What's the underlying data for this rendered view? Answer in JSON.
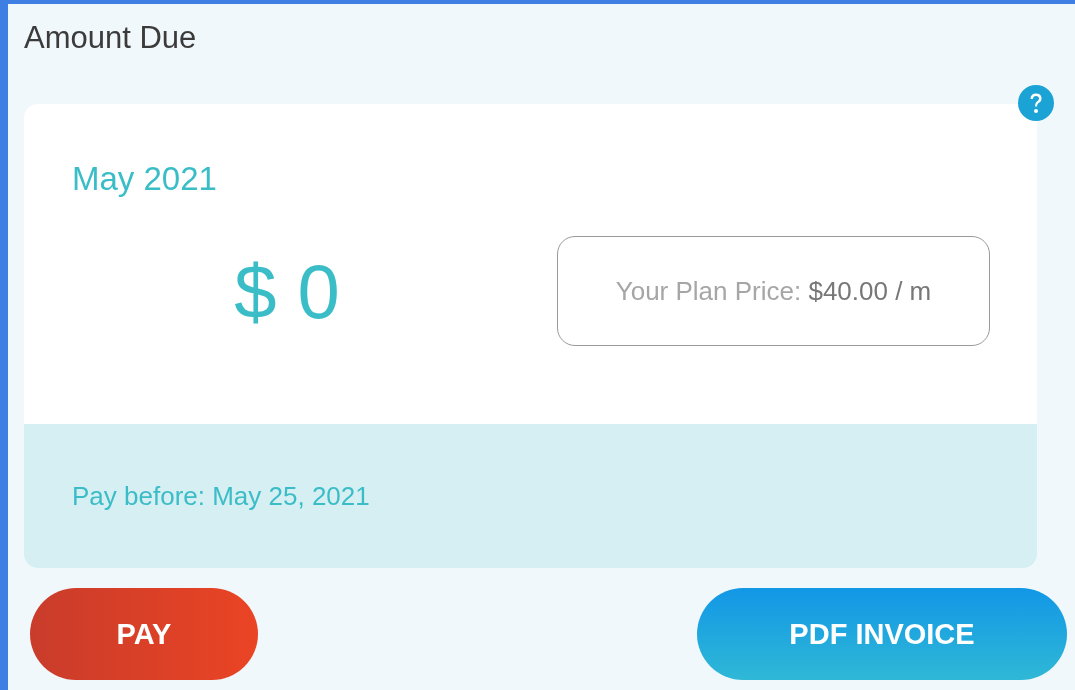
{
  "title": "Amount Due",
  "card": {
    "month": "May 2021",
    "amount": "$ 0",
    "plan_price": "Your Plan Price: **$40.00 / m**",
    "pay_before": "Pay before: May 25, 2021"
  },
  "buttons": [
    {
      "label": "PAY",
      "kind": "danger"
    },
    {
      "label": "PDF INVOICE",
      "kind": "primary"
    }
  ]
}
